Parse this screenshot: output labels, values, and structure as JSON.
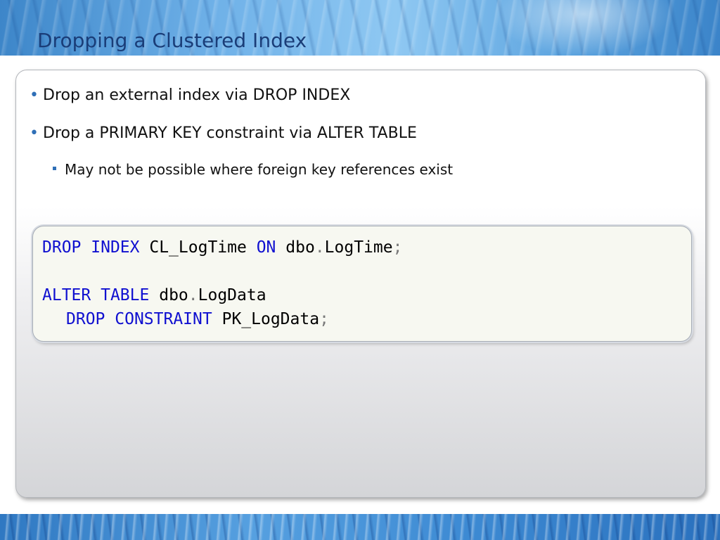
{
  "slide": {
    "title": "Dropping a Clustered Index"
  },
  "bullets": [
    {
      "marker": "•",
      "text": "Drop an external index via DROP INDEX"
    },
    {
      "marker": "•",
      "text": "Drop a PRIMARY KEY constraint via ALTER TABLE"
    }
  ],
  "sub_bullets": [
    {
      "text": "May not be possible where foreign key references exist"
    }
  ],
  "code": {
    "line1": {
      "kw1": "DROP",
      "kw2": "INDEX",
      "index_name": "CL_LogTime",
      "kw3": "ON",
      "schema": "dbo",
      "dot": ".",
      "table": "LogTime",
      "semicolon": ";"
    },
    "line2": {
      "kw1": "ALTER",
      "kw2": "TABLE",
      "schema": "dbo",
      "dot": ".",
      "table": "LogData"
    },
    "line3": {
      "kw1": "DROP",
      "kw2": "CONSTRAINT",
      "constraint_name": "PK_LogData",
      "semicolon": ";"
    }
  },
  "colors": {
    "title": "#1a3d78",
    "keyword": "#1010d0",
    "punctuation": "#7a7a7a",
    "bullet_marker": "#2f6fb7"
  }
}
